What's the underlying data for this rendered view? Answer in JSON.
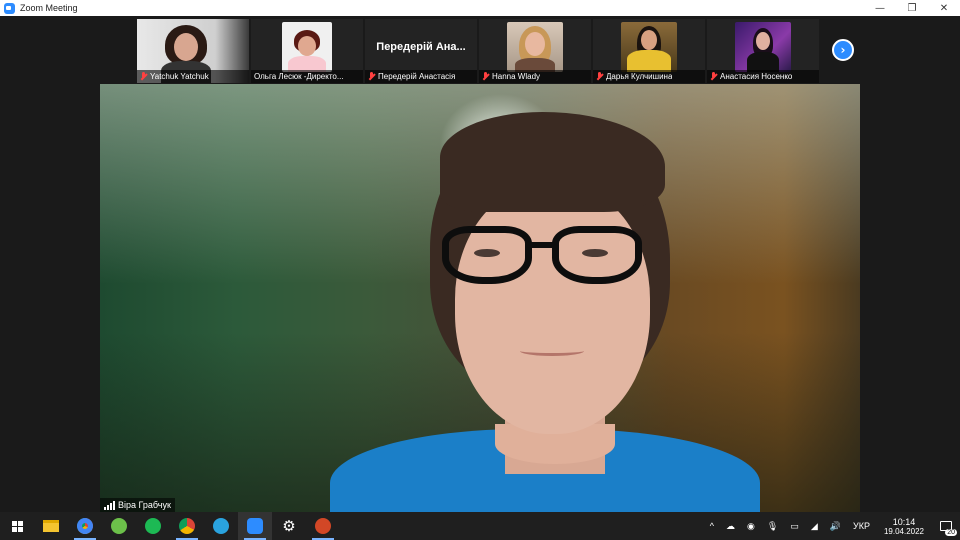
{
  "window": {
    "title": "Zoom Meeting",
    "controls": {
      "minimize": "—",
      "restore": "❐",
      "close": "✕"
    }
  },
  "participants": [
    {
      "name": "Yatchuk Yatchuk",
      "muted": true,
      "has_video": true
    },
    {
      "name": "Ольга Лесюк -Директо...",
      "muted": false,
      "has_video": true
    },
    {
      "name": "Передерій Анастасія",
      "display_name": "Передерій Ана...",
      "muted": true,
      "has_video": false
    },
    {
      "name": "Hanna Wlady",
      "muted": true,
      "has_video": true
    },
    {
      "name": "Дарья Кулчишина",
      "muted": true,
      "has_video": true
    },
    {
      "name": "Анастасия Носенко",
      "muted": true,
      "has_video": true
    }
  ],
  "strip": {
    "next_icon": "chevron-right-icon",
    "next_glyph": "›"
  },
  "active_speaker": {
    "name": "Віра Грабчук"
  },
  "taskbar": {
    "apps": [
      "windows-start-icon",
      "file-explorer-icon",
      "chrome-icon",
      "utorrent-icon",
      "spotify-icon",
      "chrome-icon",
      "telegram-icon",
      "zoom-icon",
      "settings-icon",
      "powerpoint-icon"
    ],
    "tray": {
      "chevron": "^",
      "language": "УКР",
      "time": "10:14",
      "date": "19.04.2022",
      "notifications": "20"
    }
  },
  "colors": {
    "zoom_blue": "#2d8cff",
    "muted_red": "#ff4040",
    "shirt_blue": "#1b7fc8"
  }
}
